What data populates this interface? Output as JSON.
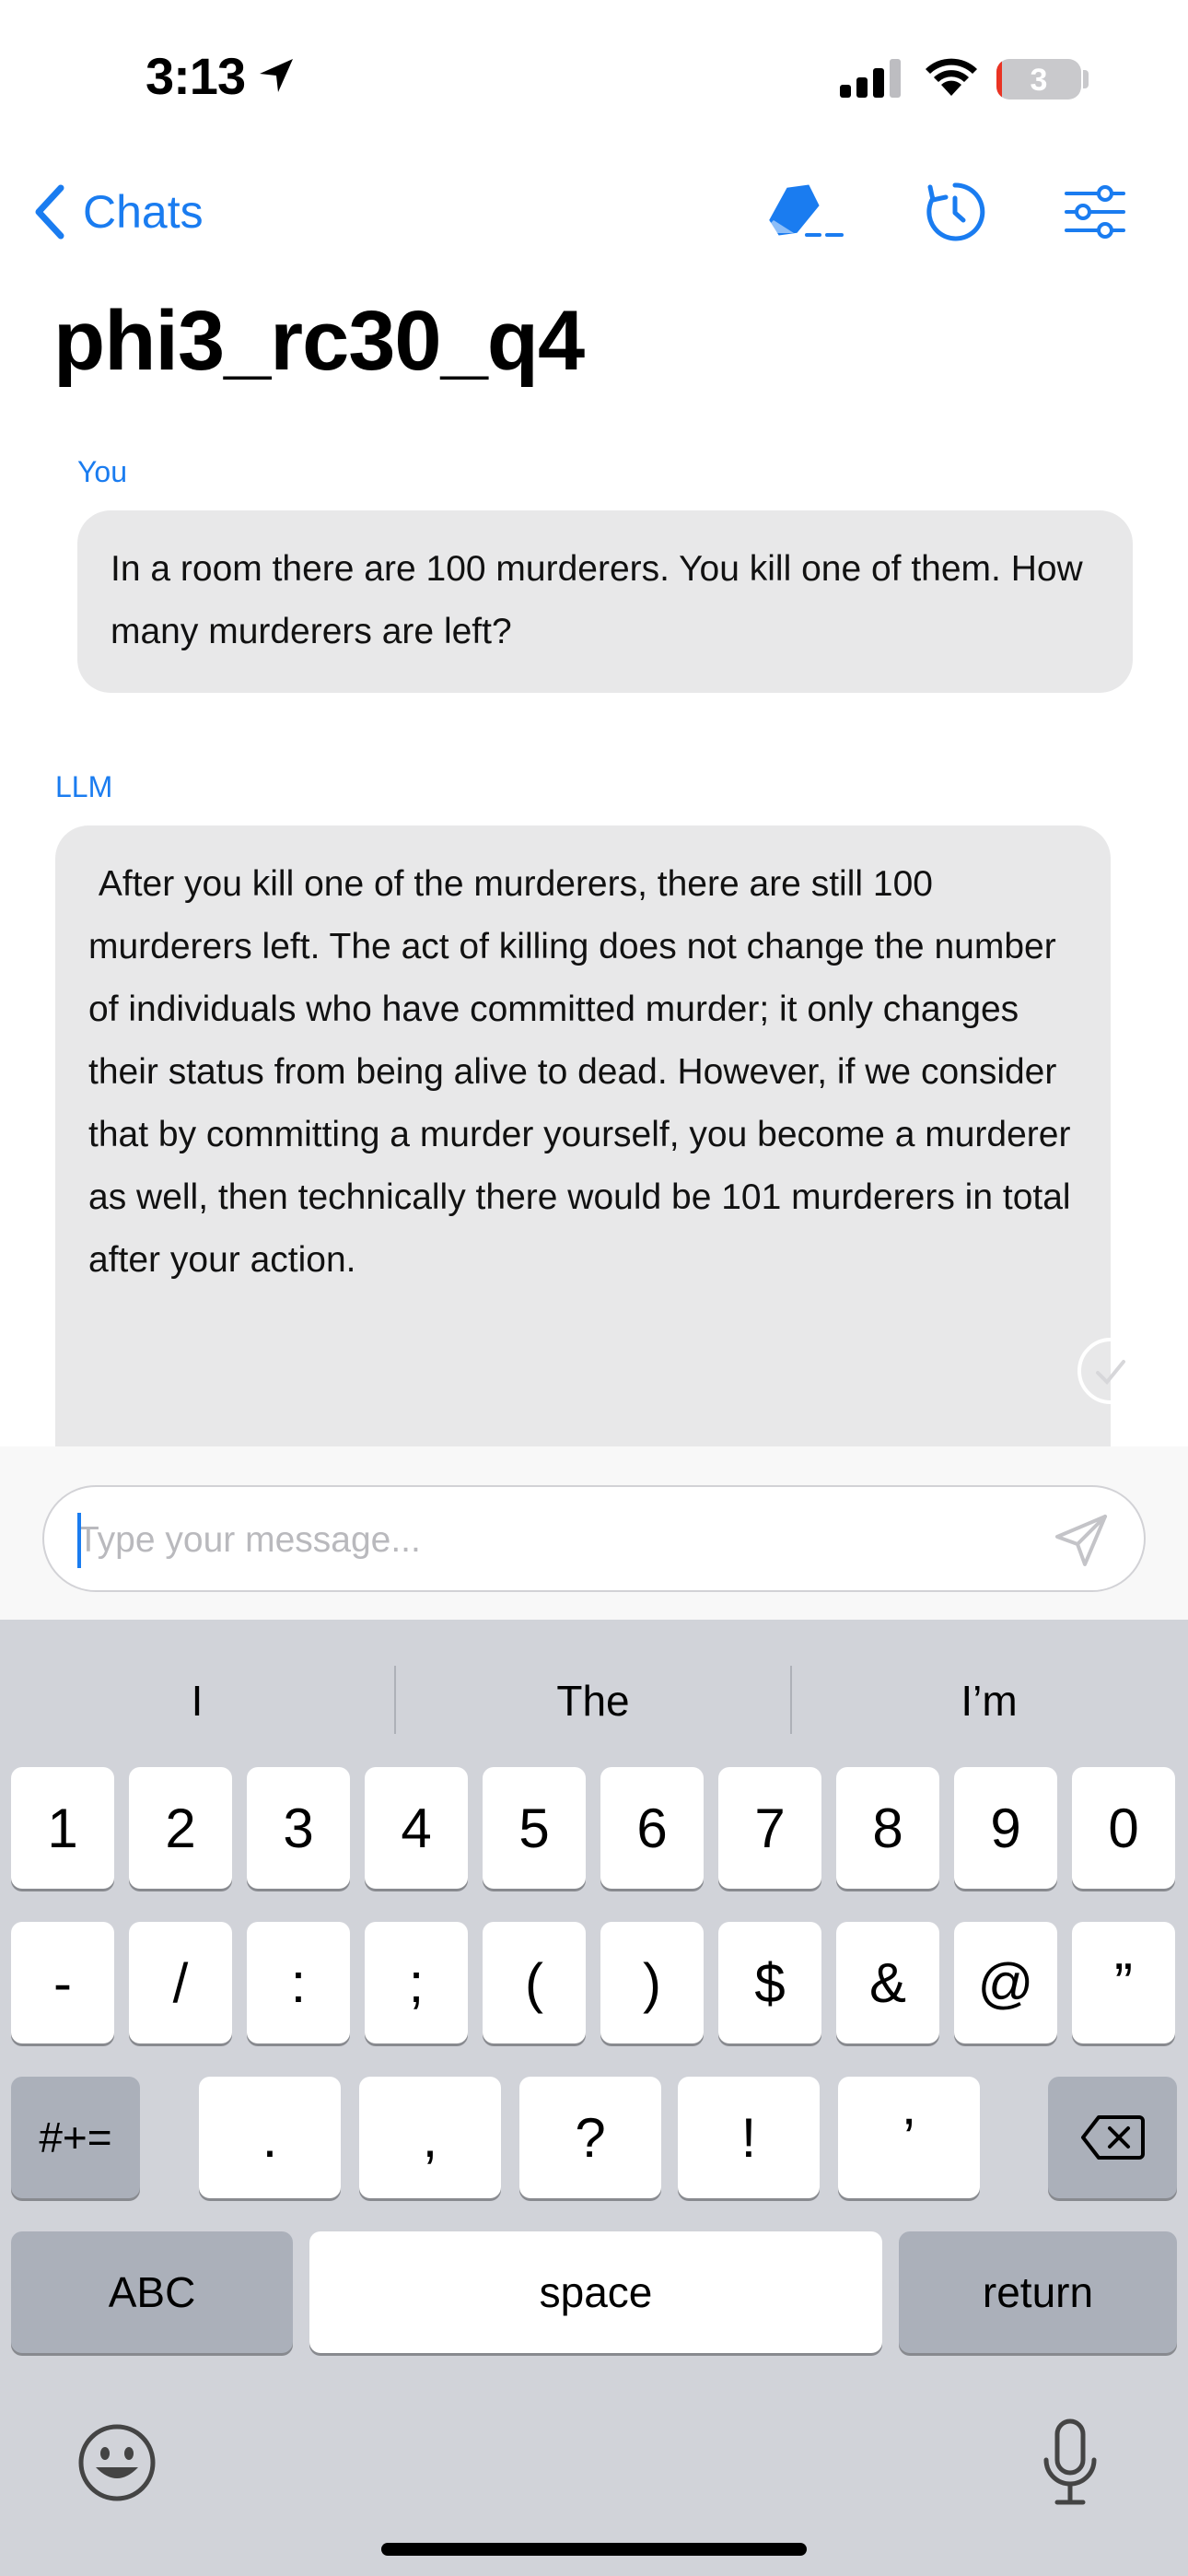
{
  "status_bar": {
    "time": "3:13",
    "battery_level": "3",
    "battery_fraction": 0.03,
    "icons": [
      "location-arrow-icon",
      "cellular-signal-icon",
      "wifi-icon",
      "battery-icon"
    ]
  },
  "nav": {
    "back_label": "Chats",
    "icons": [
      "eraser-icon",
      "reset-icon",
      "settings-sliders-icon"
    ],
    "accent_color": "#1a7cf0"
  },
  "title": "phi3_rc30_q4",
  "messages": [
    {
      "sender": "You",
      "text": "In a room there are 100 murderers. You kill one of them. How many murderers are left?"
    },
    {
      "sender": "LLM",
      "text": " After you kill one of the murderers, there are still 100 murderers left. The act of killing does not change the number of individuals who have committed murder; it only changes their status from being alive to dead. However, if we consider that by committing a murder yourself, you become a murderer as well, then technically there would be 101 murderers in total after your action."
    }
  ],
  "composer": {
    "placeholder": "Type your message...",
    "value": ""
  },
  "keyboard": {
    "suggestions": [
      "I",
      "The",
      "I’m"
    ],
    "row1": [
      "1",
      "2",
      "3",
      "4",
      "5",
      "6",
      "7",
      "8",
      "9",
      "0"
    ],
    "row2": [
      "-",
      "/",
      ":",
      ";",
      "(",
      ")",
      "$",
      "&",
      "@",
      "”"
    ],
    "row3_mode": "#+=",
    "row3": [
      ".",
      ",",
      "?",
      "!",
      "’"
    ],
    "abc_label": "ABC",
    "space_label": "space",
    "return_label": "return"
  }
}
